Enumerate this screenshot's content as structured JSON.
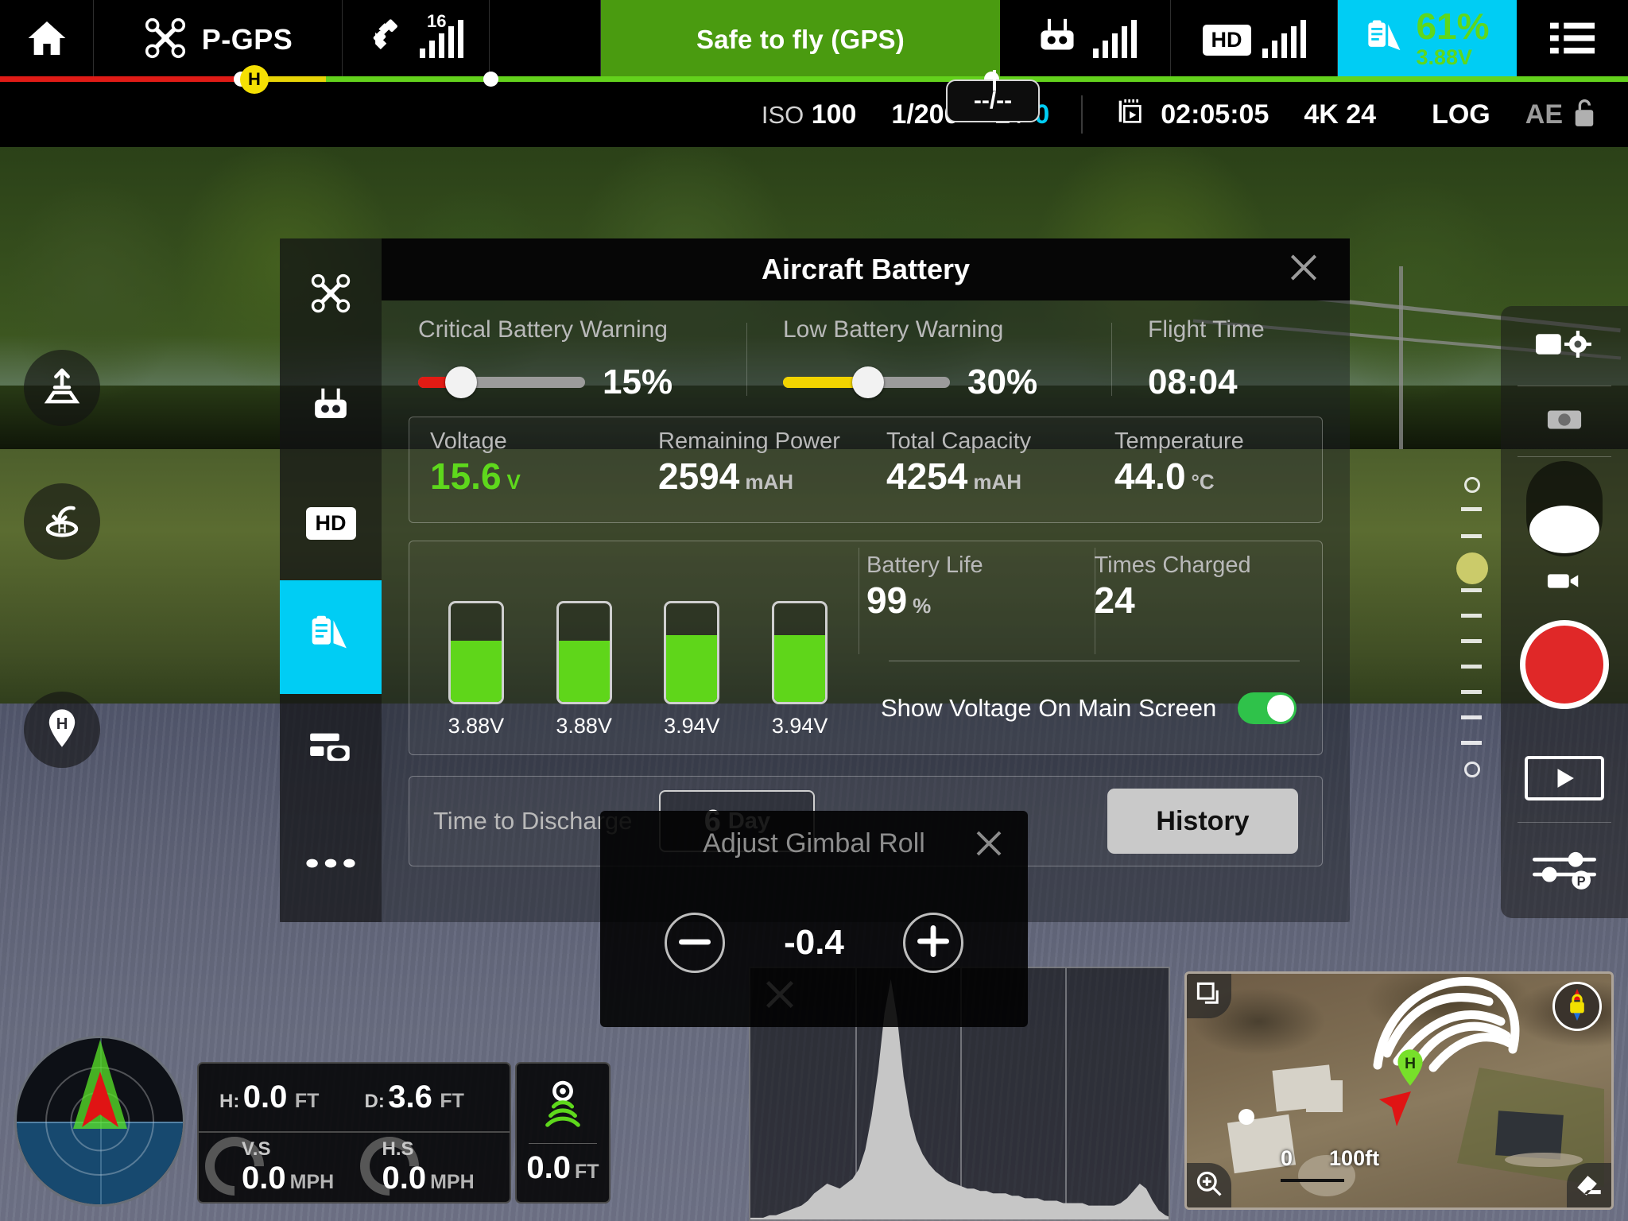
{
  "topbar": {
    "home_icon": "home-icon",
    "aircraft_icon": "drone-icon",
    "flight_mode": "P-GPS",
    "satellite_icon": "satellite-icon",
    "satellite_count": "16",
    "status_message": "Safe to fly (GPS)",
    "rc_icon": "remote-controller-icon",
    "hd_label": "HD",
    "battery_icon": "battery-clipboard-icon",
    "battery_percent": "61%",
    "battery_voltage": "3.88V",
    "menu_icon": "hamburger-menu-icon",
    "home_marker": "H",
    "strip_colors": {
      "critical": "#e01b16",
      "low": "#e8d406",
      "safe": "#63d21c"
    }
  },
  "camera_info": {
    "focus_value": "--/--",
    "iso_label": "ISO",
    "iso_value": "100",
    "shutter": "1/200",
    "ev_label": "EV",
    "ev_value": "0",
    "rec_icon": "video-clip-icon",
    "record_time": "02:05:05",
    "resolution": "4K 24",
    "color_profile": "LOG",
    "ae_label": "AE",
    "ae_lock_icon": "unlocked-padlock-icon"
  },
  "left_buttons": [
    {
      "name": "takeoff-button",
      "icon": "takeoff-arrow-icon"
    },
    {
      "name": "return-to-home-button",
      "icon": "return-to-home-icon"
    },
    {
      "name": "home-point-button",
      "icon": "home-pin-icon"
    }
  ],
  "right_panel": {
    "camera_settings_icon": "camera-gear-icon",
    "photo_icon": "camera-icon",
    "mode_dial_icon": "mode-dial-icon",
    "video_icon": "video-camera-icon",
    "shutter_icon": "record-shutter-button",
    "playback_icon": "playback-play-icon",
    "sliders_icon": "sliders-p-icon"
  },
  "dialog": {
    "title": "Aircraft Battery",
    "close_icon": "close-icon",
    "sidebar": [
      {
        "name": "sidebar-item-aircraft",
        "icon": "drone-icon",
        "active": false
      },
      {
        "name": "sidebar-item-remote-controller",
        "icon": "remote-controller-icon",
        "active": false
      },
      {
        "name": "sidebar-item-image-transmission",
        "icon": "hd-icon",
        "label": "HD",
        "active": false
      },
      {
        "name": "sidebar-item-battery",
        "icon": "battery-clipboard-icon",
        "active": true
      },
      {
        "name": "sidebar-item-gimbal",
        "icon": "gimbal-icon",
        "active": false
      },
      {
        "name": "sidebar-item-more",
        "icon": "ellipsis-icon",
        "active": false
      }
    ],
    "critical_warning": {
      "label": "Critical Battery Warning",
      "value": "15%",
      "percent": 15,
      "color": "#e21b14"
    },
    "low_warning": {
      "label": "Low Battery Warning",
      "value": "30%",
      "percent": 30,
      "color": "#f2d400"
    },
    "flight_time": {
      "label": "Flight Time",
      "value": "08:04"
    },
    "stats": [
      {
        "label": "Voltage",
        "value": "15.6",
        "unit": "V",
        "green": true
      },
      {
        "label": "Remaining Power",
        "value": "2594",
        "unit": "mAH",
        "green": false
      },
      {
        "label": "Total Capacity",
        "value": "4254",
        "unit": "mAH",
        "green": false
      },
      {
        "label": "Temperature",
        "value": "44.0",
        "unit": "°C",
        "green": false
      }
    ],
    "cells": [
      {
        "voltage": "3.88V",
        "fill": 62
      },
      {
        "voltage": "3.88V",
        "fill": 62
      },
      {
        "voltage": "3.94V",
        "fill": 68
      },
      {
        "voltage": "3.94V",
        "fill": 68
      }
    ],
    "battery_life": {
      "label": "Battery Life",
      "value": "99",
      "unit": "%"
    },
    "times_charged": {
      "label": "Times Charged",
      "value": "24"
    },
    "show_voltage": {
      "label": "Show Voltage On Main Screen",
      "state": "on"
    },
    "time_to_discharge": {
      "label": "Time to Discharge",
      "value": "6",
      "unit": "Day"
    },
    "history_button": "History"
  },
  "gimbal_overlay": {
    "title": "Adjust Gimbal Roll",
    "close_icon": "close-icon",
    "minus_icon": "minus-icon",
    "plus_icon": "plus-icon",
    "value": "-0.4"
  },
  "telemetry": {
    "height_label": "H:",
    "height_value": "0.0",
    "height_unit": "FT",
    "distance_label": "D:",
    "distance_value": "3.6",
    "distance_unit": "FT",
    "vs_label": "V.S",
    "vs_value": "0.0",
    "vs_unit": "MPH",
    "hs_label": "H.S",
    "hs_value": "0.0",
    "hs_unit": "MPH",
    "vps_icon": "vision-sensor-icon",
    "vps_value": "0.0",
    "vps_unit": "FT",
    "attitude_icon": "attitude-radar-indicator"
  },
  "map": {
    "layers_icon": "map-layers-icon",
    "zoom_icon": "map-zoom-icon",
    "erase_icon": "eraser-icon",
    "lock_icon": "map-lock-compass-icon",
    "home_marker": "H",
    "scale_min": "0",
    "scale_max": "100ft"
  },
  "histogram": {
    "close_icon": "close-icon",
    "points": [
      2,
      2,
      2,
      3,
      3,
      4,
      5,
      6,
      7,
      9,
      12,
      14,
      16,
      15,
      14,
      16,
      18,
      22,
      30,
      44,
      62,
      86,
      100,
      84,
      60,
      44,
      34,
      28,
      24,
      21,
      19,
      17,
      16,
      15,
      14,
      14,
      13,
      13,
      12,
      12,
      12,
      11,
      11,
      10,
      10,
      10,
      9,
      9,
      9,
      8,
      8,
      8,
      8,
      7,
      7,
      7,
      7,
      7,
      8,
      10,
      13,
      16,
      14,
      9,
      5,
      3,
      2
    ]
  }
}
